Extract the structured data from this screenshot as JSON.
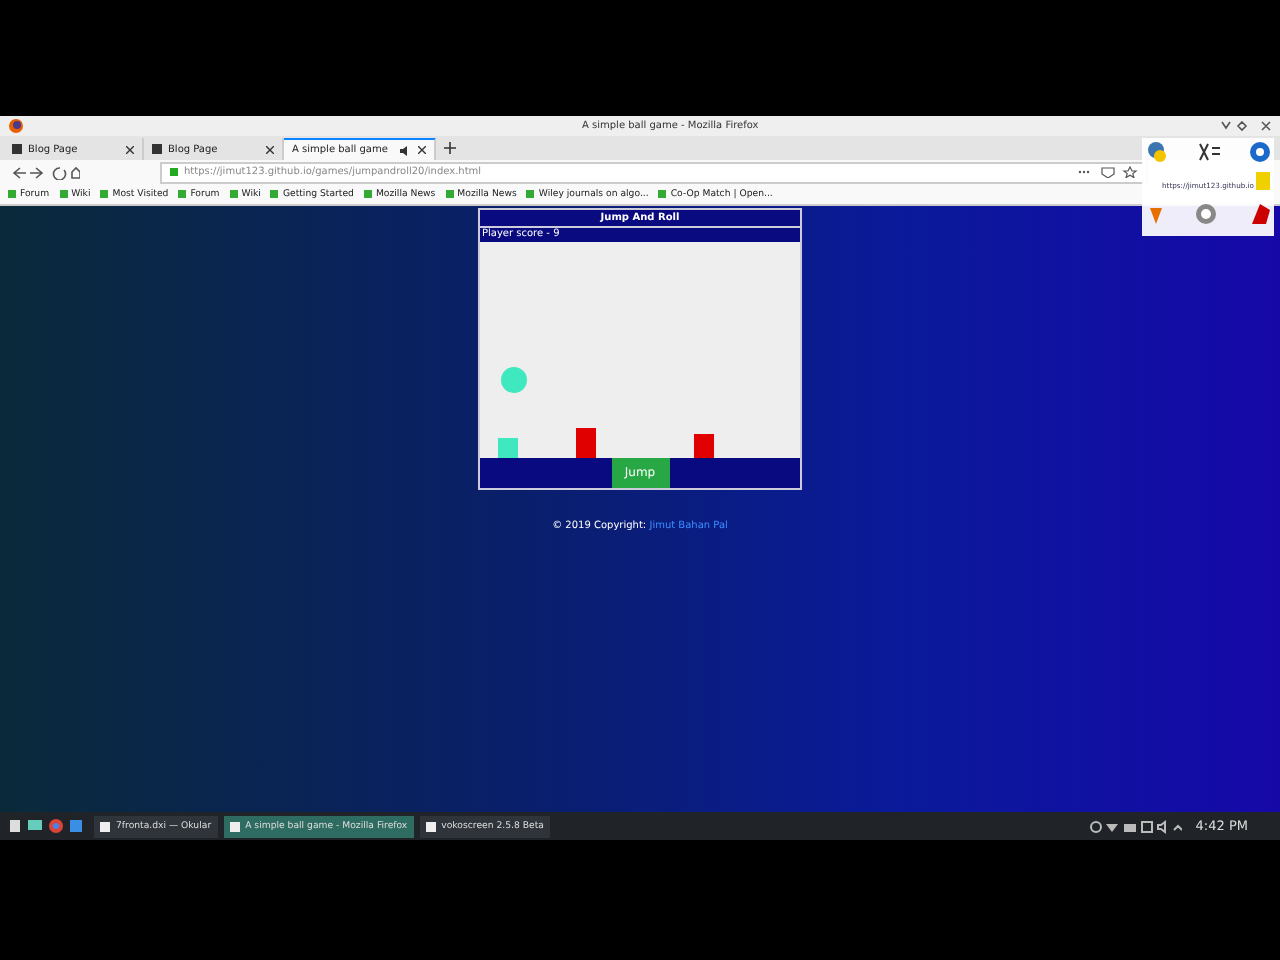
{
  "window": {
    "title": "A simple ball game - Mozilla Firefox"
  },
  "tabs": [
    {
      "label": "Blog Page",
      "selected": false
    },
    {
      "label": "Blog Page",
      "selected": false
    },
    {
      "label": "A simple ball game",
      "selected": true,
      "audio": true
    }
  ],
  "address_bar": {
    "value": "https://jimut123.github.io/games/jumpandroll20/index.html"
  },
  "bookmarks": [
    "Forum",
    "Wiki",
    "Most Visited",
    "Forum",
    "Wiki",
    "Getting Started",
    "Mozilla News",
    "Mozilla News",
    "Wiley journals on algo...",
    "Co-Op Match | Open..."
  ],
  "game": {
    "title": "Jump And Roll",
    "score": "Player score - 9",
    "button": "Jump"
  },
  "footer": {
    "text": "© 2019 Copyright:",
    "link": "Jimut Bahan Pal"
  },
  "overlay": {
    "caption": "https://jimut123.github.io"
  },
  "taskbar": {
    "tasks": [
      {
        "label": "7fronta.dxi  — Okular",
        "selected": false
      },
      {
        "label": "A simple ball game - Mozilla Firefox",
        "selected": true
      },
      {
        "label": "vokoscreen 2.5.8 Beta",
        "selected": false
      }
    ],
    "clock": "4:42 PM"
  }
}
